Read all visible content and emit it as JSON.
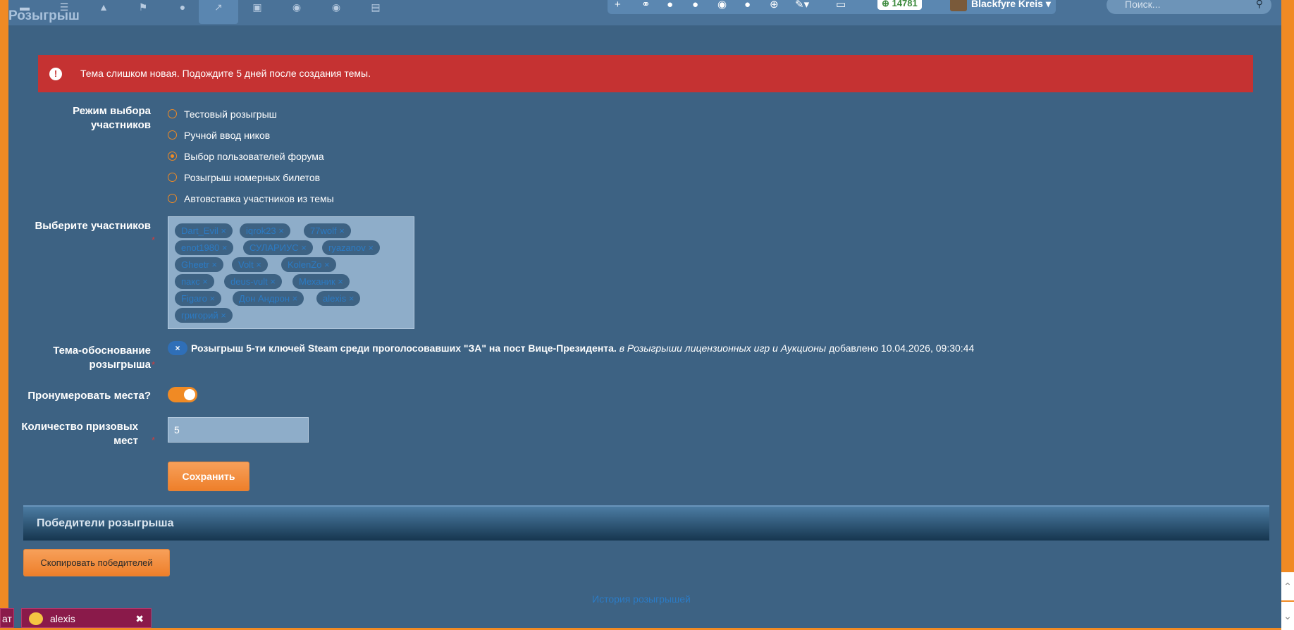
{
  "header": {
    "page_title": "Розыгрыш",
    "nav_icons": [
      "comment-icon",
      "list-icon",
      "megaphone-icon",
      "flag-icon",
      "users-icon",
      "chart-icon",
      "book-icon",
      "chat-icon",
      "chat-bubbles-icon",
      "document-icon"
    ],
    "userbar_icons": [
      "plus-icon",
      "link-icon",
      "globe-icon",
      "user-icon",
      "comments-icon",
      "alert-icon",
      "add-circle-icon",
      "pen-icon",
      "folder-icon"
    ],
    "points": "14781",
    "username": "Blackfyre Kreis",
    "search_placeholder": "Поиск..."
  },
  "error": {
    "text": "Тема слишком новая. Подождите 5 дней после создания темы."
  },
  "form": {
    "mode_label": "Режим выбора участников",
    "mode_options": [
      {
        "label": "Тестовый розыгрыш",
        "checked": false
      },
      {
        "label": "Ручной ввод ников",
        "checked": false
      },
      {
        "label": "Выбор пользователей форума",
        "checked": true
      },
      {
        "label": "Розыгрыш номерных билетов",
        "checked": false
      },
      {
        "label": "Автовставка участников из темы",
        "checked": false
      }
    ],
    "participants_label": "Выберите участников",
    "participants": [
      "Dart_Evil ×",
      "iqrok23 ×",
      "77wolf ×",
      "enot1980 ×",
      "СУЛАРИУС ×",
      "ryazanov ×",
      "Gheetr ×",
      "Volt ×",
      "KolenZo ×",
      "пакс ×",
      "deus-vult ×",
      "Механик ×",
      "Figaro ×",
      "Дон Андрон ×",
      "alexis ×",
      "григорий ×"
    ],
    "theme_label": "Тема-обоснование розыгрыша",
    "theme_chip": "×",
    "theme_title": "Розыгрыш 5-ти ключей Steam среди проголосовавших \"ЗА\" на пост Вице-Президента.",
    "theme_forum": "в Розыгрыши лицензионных игр и Аукционы",
    "theme_added": "добавлено 10.04.2026, 09:30:44",
    "number_places_label": "Пронумеровать места?",
    "number_places_on": true,
    "prize_count_label": "Количество призовых мест",
    "prize_count_value": "5",
    "save_button": "Сохранить"
  },
  "winners": {
    "header": "Победители розыгрыша",
    "copy_button": "Скопировать победителей",
    "history_link": "История розыгрышей"
  },
  "chat": {
    "left_fragment": "ат",
    "tab_name": "alexis",
    "close": "✖"
  },
  "colors": {
    "background": "#3d6283",
    "accent": "#f08a24",
    "error": "#c53232",
    "link": "#2c7bc4"
  }
}
